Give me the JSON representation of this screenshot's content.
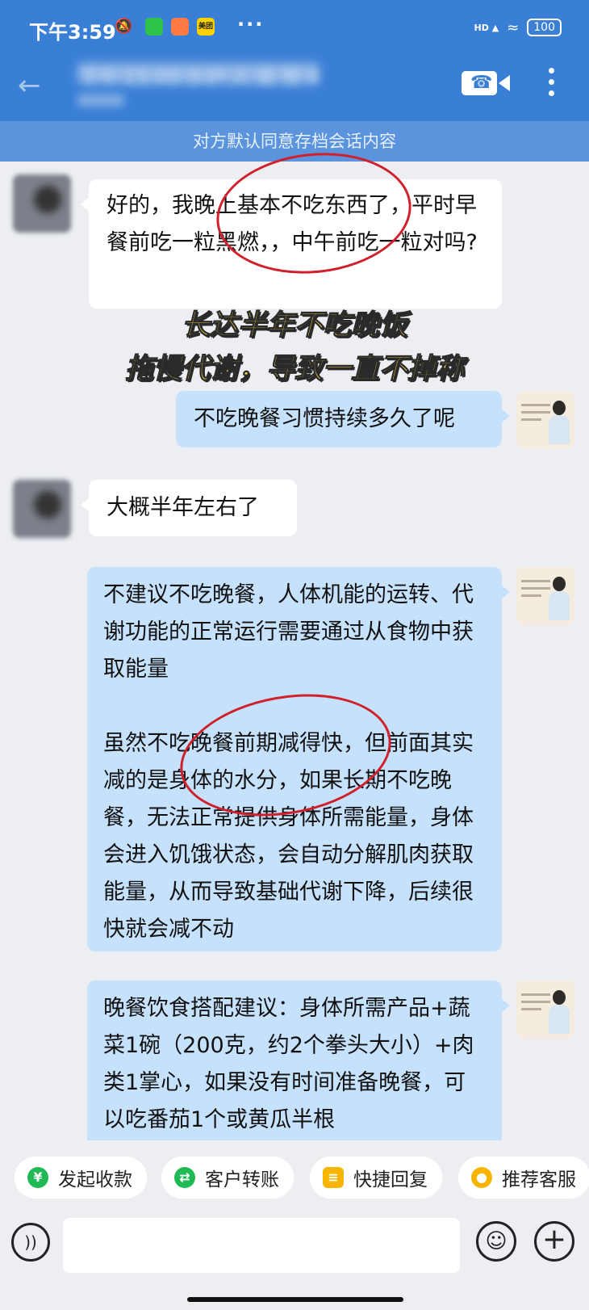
{
  "status_bar": {
    "time": "下午3:59",
    "notification_icons": [
      "mute-icon",
      "wechat-icon",
      "taobao-icon",
      "meituan-icon"
    ],
    "meituan_label": "美团",
    "more": "···",
    "hd_label": "HD",
    "battery": "100"
  },
  "header": {
    "chat_title": "下午 15:00 水护 人 量 整 4",
    "colors": {
      "header_bg": "#3a7fd6",
      "notice_bg": "#5b93dc"
    }
  },
  "notice": "对方默认同意存档会话内容",
  "messages": [
    {
      "side": "left",
      "text": "好的，我晚上基本不吃东西了，平时早餐前吃一粒黑燃，，中午前吃一粒对吗?"
    },
    {
      "side": "right",
      "text": "不吃晚餐习惯持续多久了呢"
    },
    {
      "side": "left",
      "text": "大概半年左右了"
    },
    {
      "side": "right",
      "paragraphs": [
        "不建议不吃晚餐，人体机能的运转、代谢功能的正常运行需要通过从食物中获取能量",
        "虽然不吃晚餐前期减得快，但前面其实减的是身体的水分，如果长期不吃晚餐，无法正常提供身体所需能量，身体会进入饥饿状态，会自动分解肌肉获取能量，从而导致基础代谢下降，后续很快就会减不动"
      ]
    },
    {
      "side": "right",
      "text": "晚餐饮食搭配建议：身体所需产品+蔬菜1碗（200克，约2个拳头大小）+肉类1掌心，如果没有时间准备晚餐，可以吃番茄1个或黄瓜半根"
    }
  ],
  "overlay_caption": {
    "line1": "长达半年不吃晚饭",
    "line2": "拖慢代谢，导致一直不掉称",
    "color": "#ffe14d"
  },
  "quick_actions": [
    {
      "label": "发起收款",
      "icon": "yuan-icon",
      "color": "#1fb955"
    },
    {
      "label": "客户转账",
      "icon": "transfer-icon",
      "color": "#1fb955"
    },
    {
      "label": "快捷回复",
      "icon": "reply-icon",
      "color": "#f7b500"
    },
    {
      "label": "推荐客服",
      "icon": "service-icon",
      "color": "#f7b500"
    }
  ],
  "composer": {
    "input_value": ""
  }
}
